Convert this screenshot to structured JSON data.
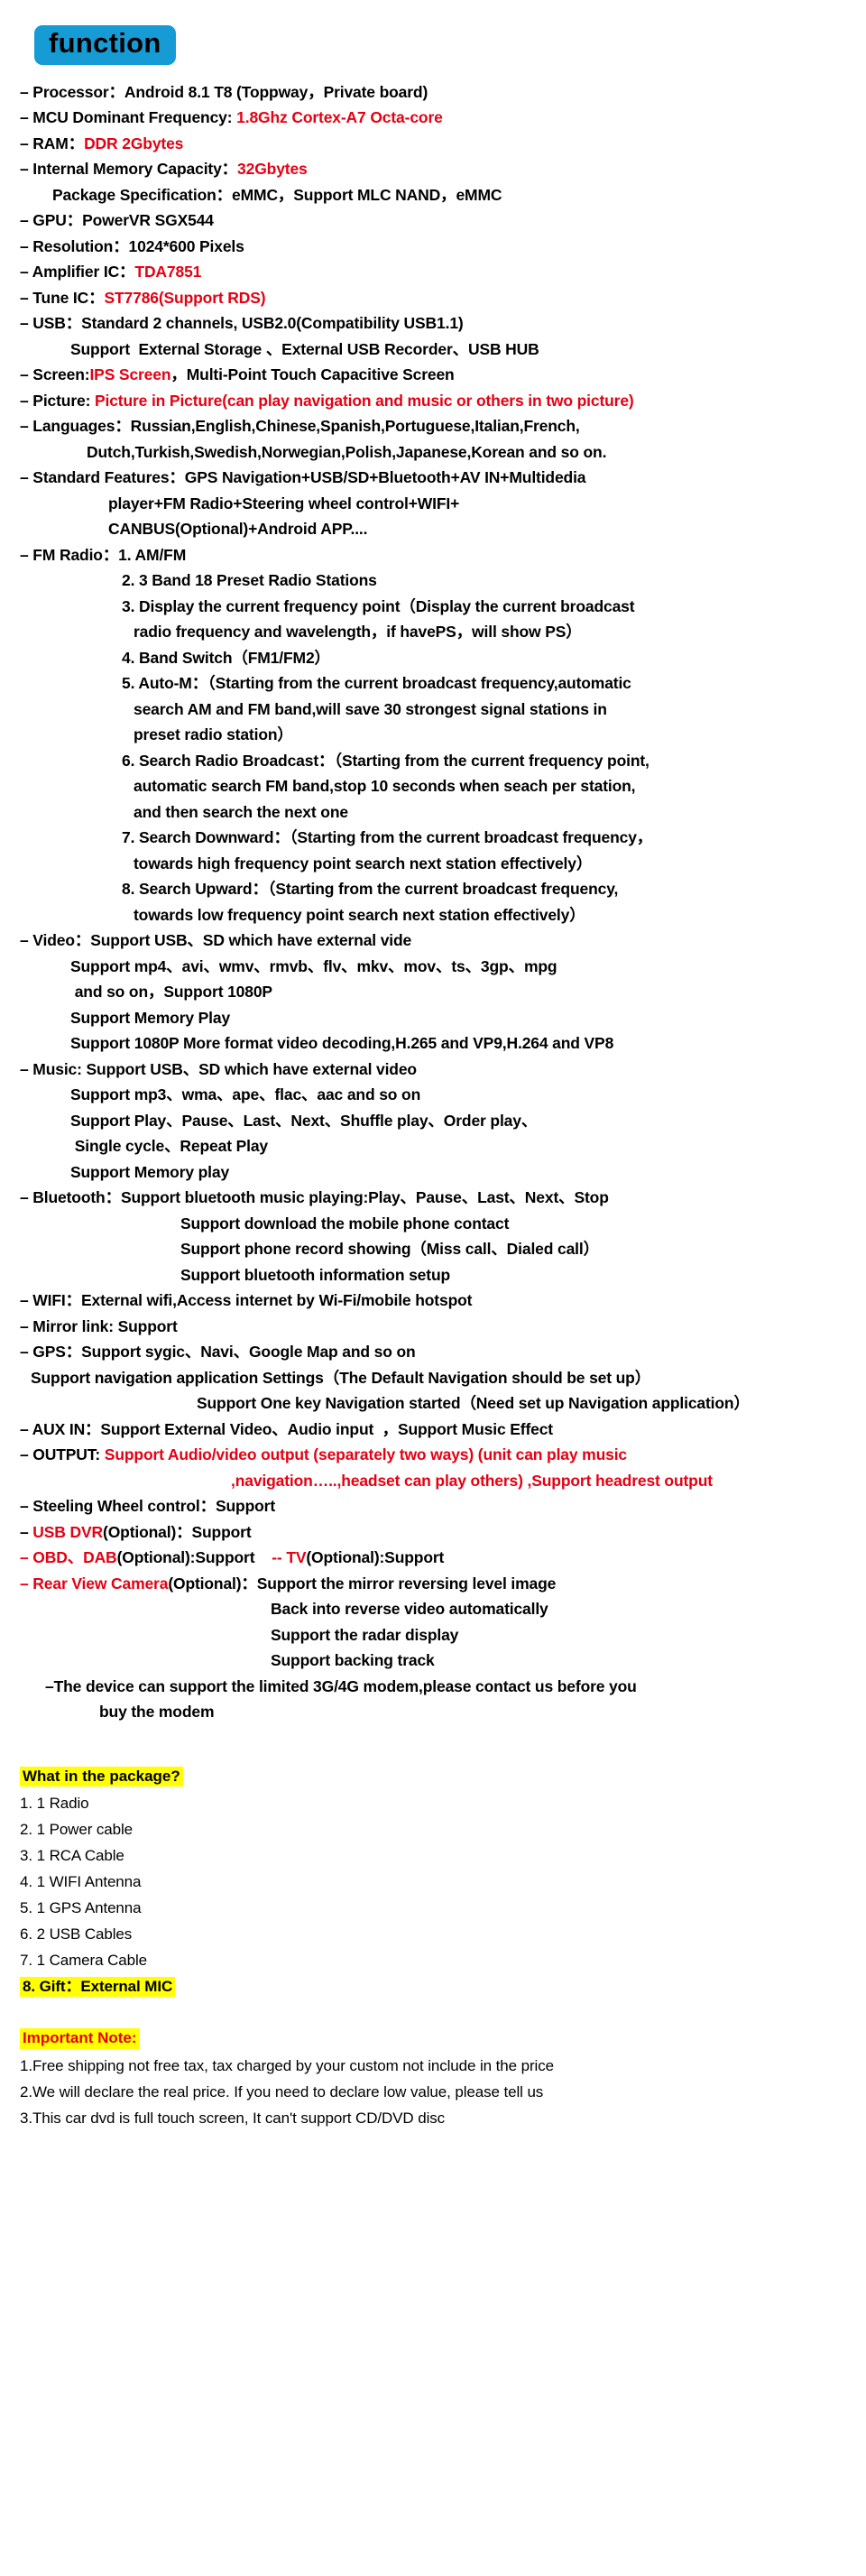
{
  "section_title": "function",
  "accent_colors": {
    "badge_bg": "#169bd5",
    "highlight_bg": "#ffff00",
    "red_text": "#e60012",
    "black_text": "#000000"
  },
  "spec_lines": [
    {
      "indent": "lvl-dash",
      "parts": [
        {
          "t": "– Processor：Android 8.1 T8 (Toppway，Private board)",
          "c": "black"
        }
      ]
    },
    {
      "indent": "lvl-dash",
      "parts": [
        {
          "t": "– MCU Dominant Frequency: ",
          "c": "black"
        },
        {
          "t": "1.8Ghz Cortex-A7 Octa-core",
          "c": "red"
        }
      ]
    },
    {
      "indent": "lvl-dash",
      "parts": [
        {
          "t": "– RAM：",
          "c": "black"
        },
        {
          "t": "DDR 2Gbytes",
          "c": "red"
        }
      ]
    },
    {
      "indent": "lvl-dash",
      "parts": [
        {
          "t": "– Internal Memory Capacity：",
          "c": "black"
        },
        {
          "t": "32Gbytes",
          "c": "red"
        }
      ]
    },
    {
      "indent": "i1",
      "parts": [
        {
          "t": "Package Specification：eMMC，Support MLC NAND，eMMC",
          "c": "black"
        }
      ]
    },
    {
      "indent": "lvl-dash",
      "parts": [
        {
          "t": "– GPU：PowerVR SGX544",
          "c": "black"
        }
      ]
    },
    {
      "indent": "lvl-dash",
      "parts": [
        {
          "t": "– Resolution：1024*600 Pixels",
          "c": "black"
        }
      ]
    },
    {
      "indent": "lvl-dash",
      "parts": [
        {
          "t": "– Amplifier IC：",
          "c": "black"
        },
        {
          "t": "TDA7851",
          "c": "red"
        }
      ]
    },
    {
      "indent": "lvl-dash",
      "parts": [
        {
          "t": "– Tune IC：",
          "c": "black"
        },
        {
          "t": "ST7786(Support RDS)",
          "c": "red"
        }
      ]
    },
    {
      "indent": "lvl-dash",
      "parts": [
        {
          "t": "– USB：Standard 2 channels, USB2.0(Compatibility USB1.1)",
          "c": "black"
        }
      ]
    },
    {
      "indent": "i2",
      "parts": [
        {
          "t": "Support  External Storage 、External USB Recorder、USB HUB",
          "c": "black"
        }
      ]
    },
    {
      "indent": "lvl-dash",
      "parts": [
        {
          "t": "– Screen:",
          "c": "black"
        },
        {
          "t": "IPS Screen",
          "c": "red"
        },
        {
          "t": "，Multi-Point Touch Capacitive Screen",
          "c": "black"
        }
      ]
    },
    {
      "indent": "lvl-dash",
      "parts": [
        {
          "t": "– Picture: ",
          "c": "black"
        },
        {
          "t": "Picture in Picture(can play navigation and music or others in two picture)",
          "c": "red"
        }
      ]
    },
    {
      "indent": "lvl-dash",
      "parts": [
        {
          "t": "– Languages：Russian,English,Chinese,Spanish,Portuguese,Italian,French,",
          "c": "black"
        }
      ]
    },
    {
      "indent": "i3",
      "parts": [
        {
          "t": "Dutch,Turkish,Swedish,Norwegian,Polish,Japanese,Korean and so on.",
          "c": "black"
        }
      ]
    },
    {
      "indent": "lvl-dash",
      "parts": [
        {
          "t": "– Standard Features：GPS Navigation+USB/SD+Bluetooth+AV IN+Multidedia",
          "c": "black"
        }
      ]
    },
    {
      "indent": "i4",
      "parts": [
        {
          "t": "player+FM Radio+Steering wheel control+WIFI+",
          "c": "black"
        }
      ]
    },
    {
      "indent": "i4",
      "parts": [
        {
          "t": "CANBUS(Optional)+Android APP....",
          "c": "black"
        }
      ]
    },
    {
      "indent": "lvl-dash",
      "parts": [
        {
          "t": "– FM Radio：1. AM/FM",
          "c": "black"
        }
      ]
    },
    {
      "indent": "i5",
      "parts": [
        {
          "t": "2. 3 Band 18 Preset Radio Stations",
          "c": "black"
        }
      ]
    },
    {
      "indent": "i5",
      "parts": [
        {
          "t": "3. Display the current frequency point（Display the current broadcast",
          "c": "black"
        }
      ]
    },
    {
      "indent": "i6",
      "parts": [
        {
          "t": "radio frequency and wavelength，if havePS，will show PS）",
          "c": "black"
        }
      ]
    },
    {
      "indent": "i5",
      "parts": [
        {
          "t": "4. Band Switch（FM1/FM2）",
          "c": "black"
        }
      ]
    },
    {
      "indent": "i5",
      "parts": [
        {
          "t": "5. Auto-M：（Starting from the current broadcast frequency,automatic",
          "c": "black"
        }
      ]
    },
    {
      "indent": "i6",
      "parts": [
        {
          "t": "search AM and FM band,will save 30 strongest signal stations in",
          "c": "black"
        }
      ]
    },
    {
      "indent": "i6",
      "parts": [
        {
          "t": "preset radio station）",
          "c": "black"
        }
      ]
    },
    {
      "indent": "i5",
      "parts": [
        {
          "t": "6. Search Radio Broadcast：（Starting from the current frequency point,",
          "c": "black"
        }
      ]
    },
    {
      "indent": "i6",
      "parts": [
        {
          "t": "automatic search FM band,stop 10 seconds when seach per station,",
          "c": "black"
        }
      ]
    },
    {
      "indent": "i6",
      "parts": [
        {
          "t": "and then search the next one",
          "c": "black"
        }
      ]
    },
    {
      "indent": "i5",
      "parts": [
        {
          "t": "7. Search Downward：（Starting from the current broadcast frequency，",
          "c": "black"
        }
      ]
    },
    {
      "indent": "i6",
      "parts": [
        {
          "t": "towards high frequency point search next station effectively）",
          "c": "black"
        }
      ]
    },
    {
      "indent": "i5",
      "parts": [
        {
          "t": "8. Search Upward：（Starting from the current broadcast frequency,",
          "c": "black"
        }
      ]
    },
    {
      "indent": "i6",
      "parts": [
        {
          "t": "towards low frequency point search next station effectively）",
          "c": "black"
        }
      ]
    },
    {
      "indent": "lvl-dash",
      "parts": [
        {
          "t": "– Video：Support USB、SD which have external vide",
          "c": "black"
        }
      ]
    },
    {
      "indent": "i2",
      "parts": [
        {
          "t": "Support mp4、avi、wmv、rmvb、flv、mkv、mov、ts、3gp、mpg",
          "c": "black"
        }
      ]
    },
    {
      "indent": "i2",
      "parts": [
        {
          "t": " and so on，Support 1080P",
          "c": "black"
        }
      ]
    },
    {
      "indent": "i2",
      "parts": [
        {
          "t": "Support Memory Play",
          "c": "black"
        }
      ]
    },
    {
      "indent": "i2",
      "parts": [
        {
          "t": "Support 1080P More format video decoding,H.265 and VP9,H.264 and VP8",
          "c": "black"
        }
      ]
    },
    {
      "indent": "lvl-dash",
      "parts": [
        {
          "t": "– Music: Support USB、SD which have external video",
          "c": "black"
        }
      ]
    },
    {
      "indent": "i2",
      "parts": [
        {
          "t": "Support mp3、wma、ape、flac、aac and so on",
          "c": "black"
        }
      ]
    },
    {
      "indent": "i2",
      "parts": [
        {
          "t": "Support Play、Pause、Last、Next、Shuffle play、Order play、",
          "c": "black"
        }
      ]
    },
    {
      "indent": "i2",
      "parts": [
        {
          "t": " Single cycle、Repeat Play",
          "c": "black"
        }
      ]
    },
    {
      "indent": "i2",
      "parts": [
        {
          "t": "Support Memory play",
          "c": "black"
        }
      ]
    },
    {
      "indent": "lvl-dash",
      "parts": [
        {
          "t": "– Bluetooth：Support bluetooth music playing:Play、Pause、Last、Next、Stop",
          "c": "black"
        }
      ]
    },
    {
      "indent": "i9",
      "parts": [
        {
          "t": "Support download the mobile phone contact",
          "c": "black"
        }
      ]
    },
    {
      "indent": "i9",
      "parts": [
        {
          "t": "Support phone record showing（Miss call、Dialed call）",
          "c": "black"
        }
      ]
    },
    {
      "indent": "i9",
      "parts": [
        {
          "t": "Support bluetooth information setup",
          "c": "black"
        }
      ]
    },
    {
      "indent": "lvl-dash",
      "parts": [
        {
          "t": "– WIFI：External wifi,Access internet by Wi-Fi/mobile hotspot",
          "c": "black"
        }
      ]
    },
    {
      "indent": "lvl-dash",
      "parts": [
        {
          "t": "– Mirror link: Support",
          "c": "black"
        }
      ]
    },
    {
      "indent": "lvl-dash",
      "parts": [
        {
          "t": "– GPS：Support sygic、Navi、Google Map and so on",
          "c": "black"
        }
      ]
    },
    {
      "indent": "i15",
      "parts": [
        {
          "t": "Support navigation application Settings（The Default Navigation should be set up）",
          "c": "black"
        }
      ]
    },
    {
      "indent": "i10",
      "parts": [
        {
          "t": "Support One key Navigation started（Need set up Navigation application）",
          "c": "black"
        }
      ]
    },
    {
      "indent": "lvl-dash",
      "parts": [
        {
          "t": "– AUX IN：Support External Video、Audio input  ，Support Music Effect",
          "c": "black"
        }
      ]
    },
    {
      "indent": "lvl-dash",
      "parts": [
        {
          "t": "– OUTPUT: ",
          "c": "black"
        },
        {
          "t": "Support Audio/video output (separately two ways) (unit can play music",
          "c": "red"
        }
      ]
    },
    {
      "indent": "i11",
      "parts": [
        {
          "t": ",navigation…..,headset can play others) ,Support headrest output",
          "c": "red"
        }
      ]
    },
    {
      "indent": "lvl-dash",
      "parts": [
        {
          "t": "– Steeling Wheel control：Support",
          "c": "black"
        }
      ]
    },
    {
      "indent": "lvl-dash",
      "parts": [
        {
          "t": "– ",
          "c": "black"
        },
        {
          "t": "USB DVR",
          "c": "red"
        },
        {
          "t": "(Optional)：Support",
          "c": "black"
        }
      ]
    },
    {
      "indent": "lvl-dash",
      "parts": [
        {
          "t": "– ",
          "c": "red"
        },
        {
          "t": "OBD、DAB",
          "c": "red"
        },
        {
          "t": "(Optional):Support",
          "c": "black"
        },
        {
          "t": "    -- ",
          "c": "red"
        },
        {
          "t": "TV",
          "c": "red"
        },
        {
          "t": "(Optional):Support",
          "c": "black"
        }
      ]
    },
    {
      "indent": "lvl-dash",
      "parts": [
        {
          "t": "– ",
          "c": "red"
        },
        {
          "t": "Rear View Camera",
          "c": "red"
        },
        {
          "t": "(Optional)：Support the mirror reversing level image",
          "c": "black"
        }
      ]
    },
    {
      "indent": "i12",
      "parts": [
        {
          "t": "Back into reverse video automatically",
          "c": "black"
        }
      ]
    },
    {
      "indent": "i12",
      "parts": [
        {
          "t": "Support the radar display",
          "c": "black"
        }
      ]
    },
    {
      "indent": "i12",
      "parts": [
        {
          "t": "Support backing track",
          "c": "black"
        }
      ]
    },
    {
      "indent": "i16",
      "parts": [
        {
          "t": "–The device can support the limited 3G/4G modem,please contact us before you",
          "c": "black"
        }
      ]
    },
    {
      "indent": "i17",
      "parts": [
        {
          "t": "buy the modem",
          "c": "black"
        }
      ]
    }
  ],
  "package": {
    "heading": "What in the package?",
    "items": [
      {
        "text": "1. 1 Radio",
        "highlight": false
      },
      {
        "text": "2. 1 Power cable",
        "highlight": false
      },
      {
        "text": "3. 1 RCA Cable",
        "highlight": false
      },
      {
        "text": "4. 1 WIFI  Antenna",
        "highlight": false
      },
      {
        "text": "5. 1 GPS Antenna",
        "highlight": false
      },
      {
        "text": "6. 2 USB Cables",
        "highlight": false
      },
      {
        "text": "7. 1 Camera Cable",
        "highlight": false
      },
      {
        "text": "8. Gift：External MIC",
        "highlight": true
      }
    ]
  },
  "important_note": {
    "heading": "Important Note:",
    "items": [
      "1.Free shipping not free tax, tax charged by your custom not include in the price",
      "2.We will declare the real price. If you need to declare low value, please tell us",
      "3.This car dvd is full touch screen, It can't support CD/DVD disc"
    ]
  }
}
